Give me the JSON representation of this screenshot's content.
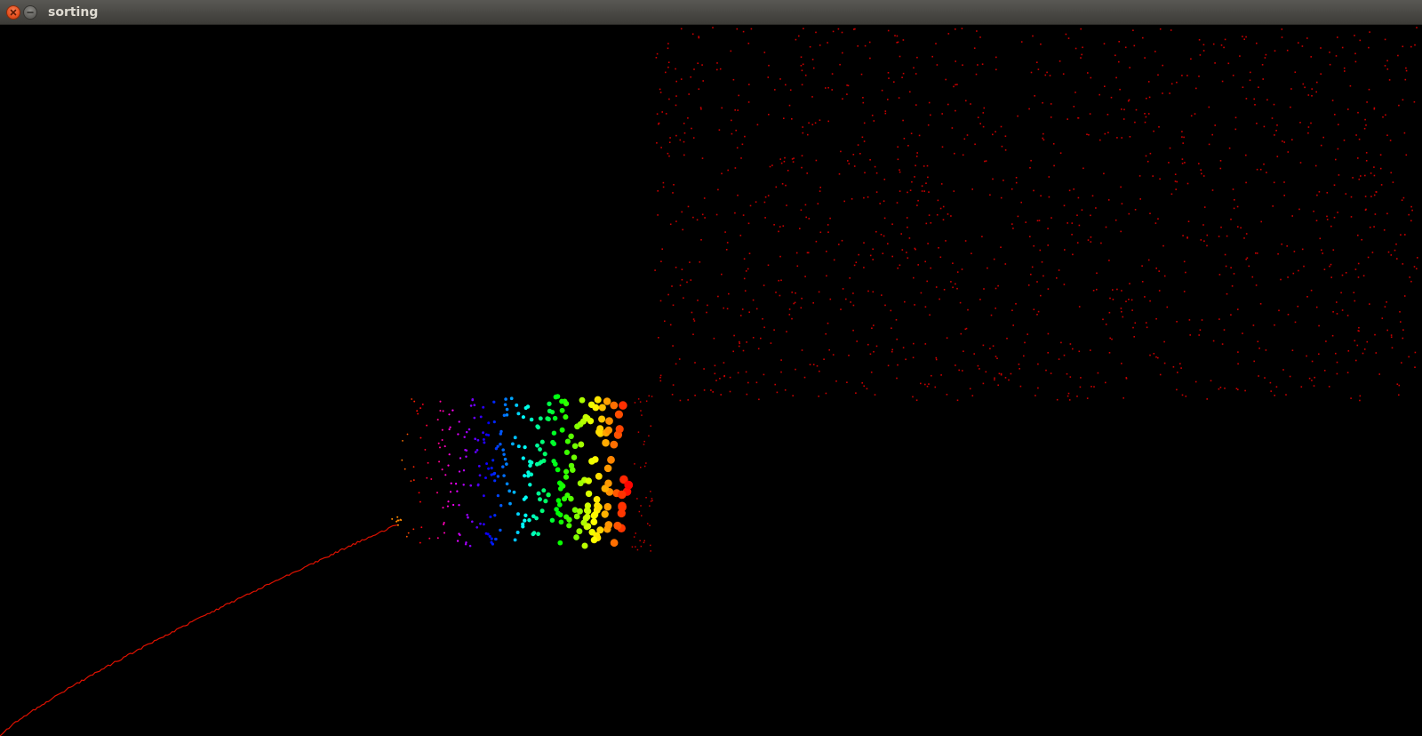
{
  "window": {
    "title": "sorting",
    "controls": [
      {
        "name": "close-button",
        "icon": "close-icon"
      },
      {
        "name": "minimize-button",
        "icon": "minimize-icon"
      }
    ]
  },
  "canvas": {
    "background": "#000000",
    "particle_color_unsorted": "#cc0000",
    "sorted_trail_color": "#dd1100"
  }
}
